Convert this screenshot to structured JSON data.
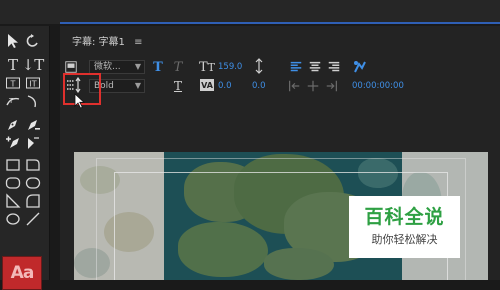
{
  "panel": {
    "tab_title": "字幕: 字幕1",
    "menu_icon": "≡"
  },
  "toolbar": {
    "font_family": "微软...",
    "font_style": "Bold",
    "font_size": "159.0",
    "kerning": "0.0",
    "tracking": "0.0",
    "leading_label": "0.0",
    "timecode": "00:00:00:00"
  },
  "tools": {
    "swatch_label": "Aa"
  },
  "watermark": {
    "title": "百科全说",
    "subtitle": "助你轻松解决"
  },
  "colors": {
    "accent": "#2f5fb5",
    "highlight": "#e0302d",
    "value_blue": "#3f8fe6",
    "swatch_red": "#c0292b",
    "watermark_green": "#2ea043"
  }
}
